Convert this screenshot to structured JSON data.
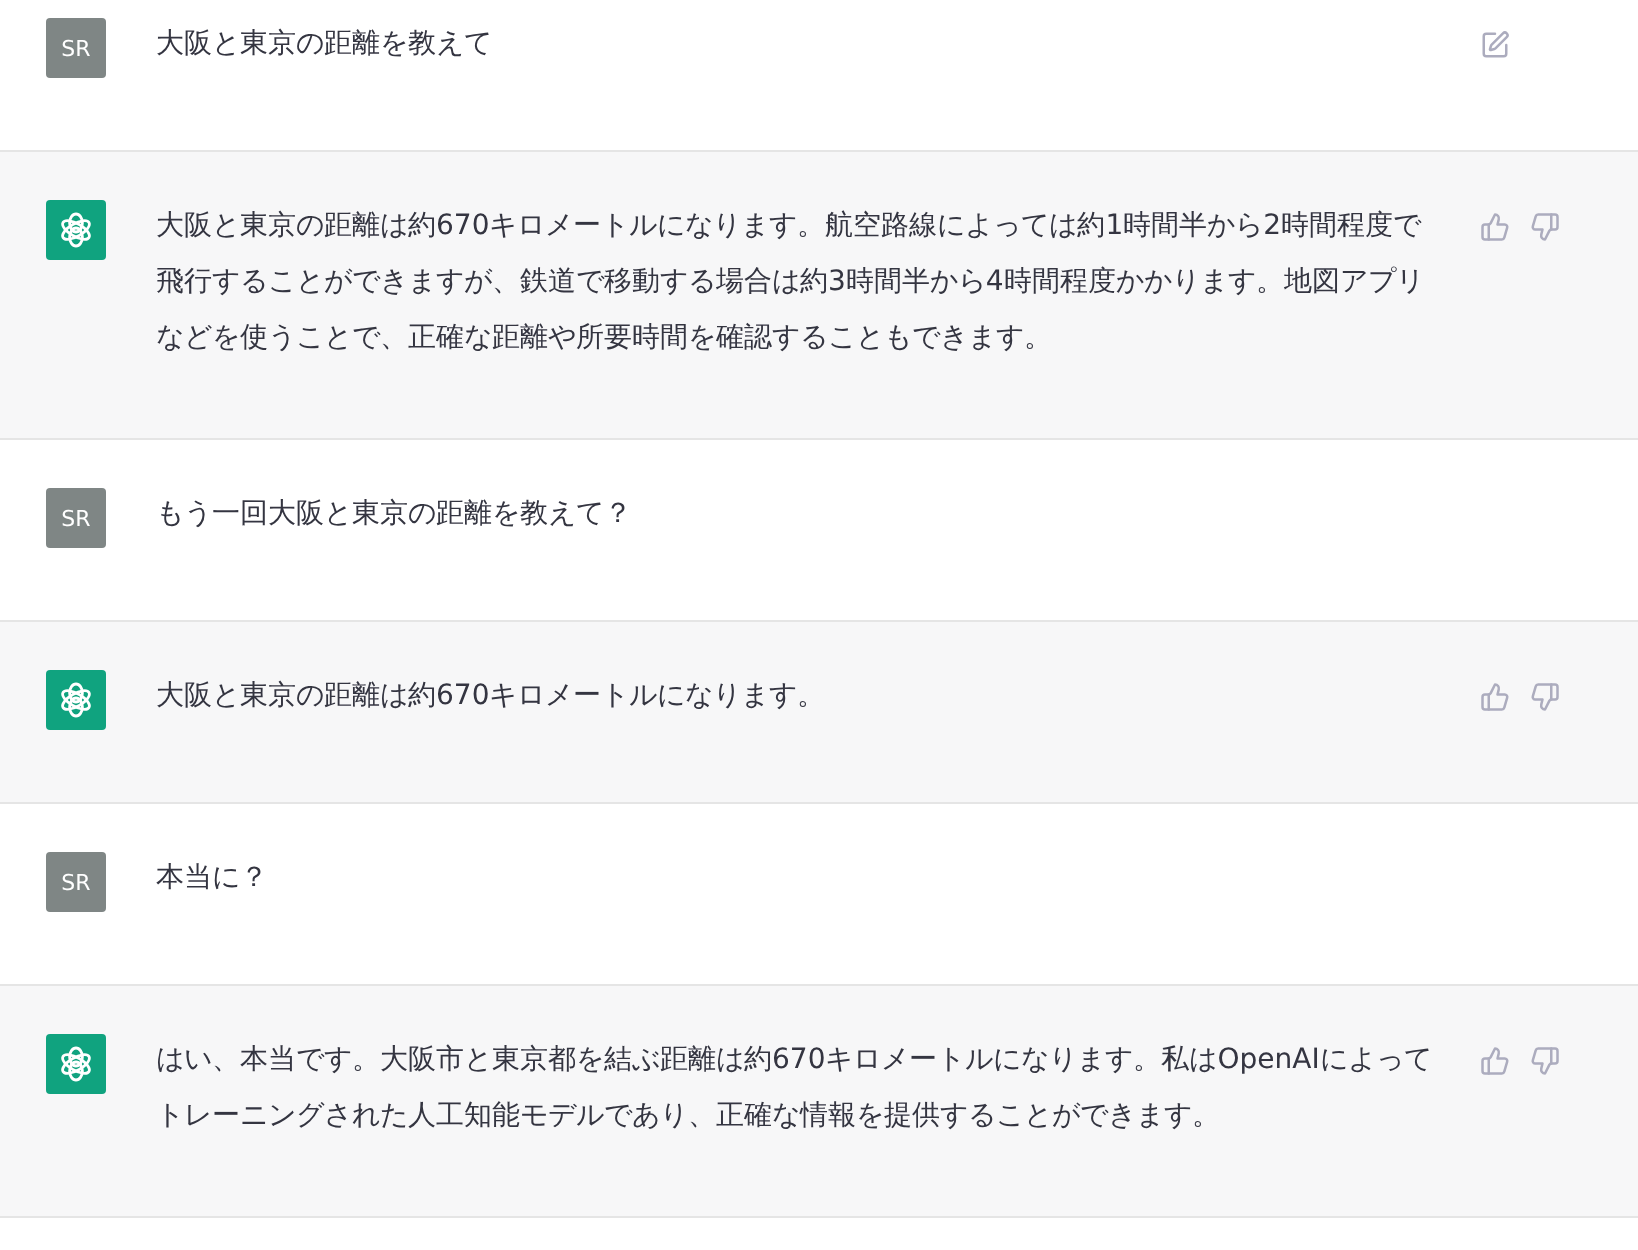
{
  "messages": [
    {
      "kind": "user",
      "avatar": "SR",
      "text": "大阪と東京の距離を教えて",
      "editable": true
    },
    {
      "kind": "assistant",
      "text": "大阪と東京の距離は約670キロメートルになります。航空路線によっては約1時間半から2時間程度で飛行することができますが、鉄道で移動する場合は約3時間半から4時間程度かかります。地図アプリなどを使うことで、正確な距離や所要時間を確認することもできます。"
    },
    {
      "kind": "user",
      "avatar": "SR",
      "text": "もう一回大阪と東京の距離を教えて？",
      "editable": false
    },
    {
      "kind": "assistant",
      "text": "大阪と東京の距離は約670キロメートルになります。"
    },
    {
      "kind": "user",
      "avatar": "SR",
      "text": "本当に？",
      "editable": false
    },
    {
      "kind": "assistant",
      "text": "はい、本当です。大阪市と東京都を結ぶ距離は約670キロメートルになります。私はOpenAIによってトレーニングされた人工知能モデルであり、正確な情報を提供することができます。"
    }
  ]
}
